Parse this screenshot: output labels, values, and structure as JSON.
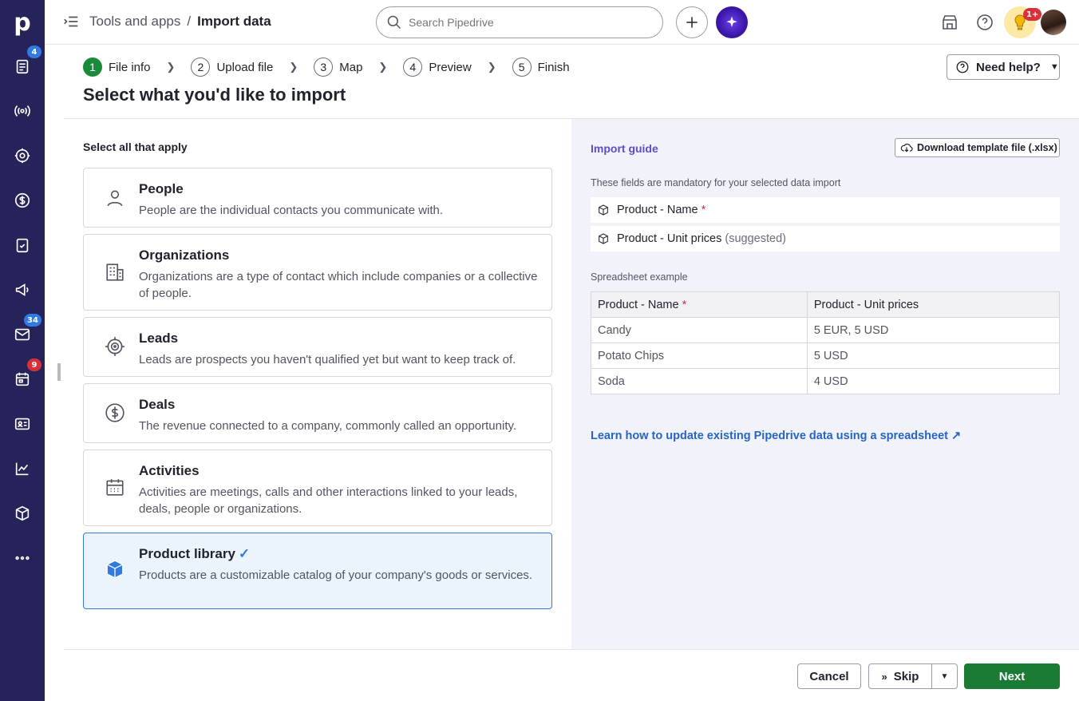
{
  "app": {
    "logo_letter": "p"
  },
  "rail": {
    "badges": {
      "deals_list": "4",
      "mail": "34",
      "calendar": "9"
    }
  },
  "header": {
    "breadcrumb_parent": "Tools and apps",
    "breadcrumb_sep": "/",
    "breadcrumb_current": "Import data",
    "search_placeholder": "Search Pipedrive",
    "notifications_badge": "1+"
  },
  "stepper": {
    "steps": [
      {
        "num": "1",
        "label": "File info"
      },
      {
        "num": "2",
        "label": "Upload file"
      },
      {
        "num": "3",
        "label": "Map"
      },
      {
        "num": "4",
        "label": "Preview"
      },
      {
        "num": "5",
        "label": "Finish"
      }
    ],
    "help_label": "Need help?"
  },
  "page": {
    "title": "Select what you'd like to import"
  },
  "options": {
    "label": "Select all that apply",
    "items": [
      {
        "title": "People",
        "desc": "People are the individual contacts you communicate with."
      },
      {
        "title": "Organizations",
        "desc": "Organizations are a type of contact which include companies or a collective of people."
      },
      {
        "title": "Leads",
        "desc": "Leads are prospects you haven't qualified yet but want to keep track of."
      },
      {
        "title": "Deals",
        "desc": "The revenue connected to a company, commonly called an opportunity."
      },
      {
        "title": "Activities",
        "desc": "Activities are meetings, calls and other interactions linked to your leads, deals, people or organizations."
      },
      {
        "title": "Product library",
        "desc": "Products are a customizable catalog of your company's goods or services.",
        "check": "✓"
      }
    ]
  },
  "guide": {
    "title": "Import guide",
    "download_label": "Download template file (.xlsx)",
    "mandatory_label": "These fields are mandatory for your selected data import",
    "fields": [
      {
        "name": "Product - Name",
        "mark": "*"
      },
      {
        "name": "Product - Unit prices",
        "note": "(suggested)"
      }
    ],
    "sheet_label": "Spreadsheet example",
    "sheet_headers": [
      "Product - Name",
      "Product - Unit prices"
    ],
    "sheet_required_mark": "*",
    "sheet_rows": [
      [
        "Candy",
        "5 EUR, 5 USD"
      ],
      [
        "Potato Chips",
        "5 USD"
      ],
      [
        "Soda",
        "4 USD"
      ]
    ],
    "learn_link": "Learn how to update existing Pipedrive data using a spreadsheet",
    "learn_link_arrow": "↗"
  },
  "footer": {
    "cancel_label": "Cancel",
    "skip_label": "Skip",
    "next_label": "Next"
  },
  "colors": {
    "rail": "#26235a",
    "primary": "#1b7a33",
    "accent_blue": "#317ae2",
    "guide_purple": "#5a4fc6"
  }
}
